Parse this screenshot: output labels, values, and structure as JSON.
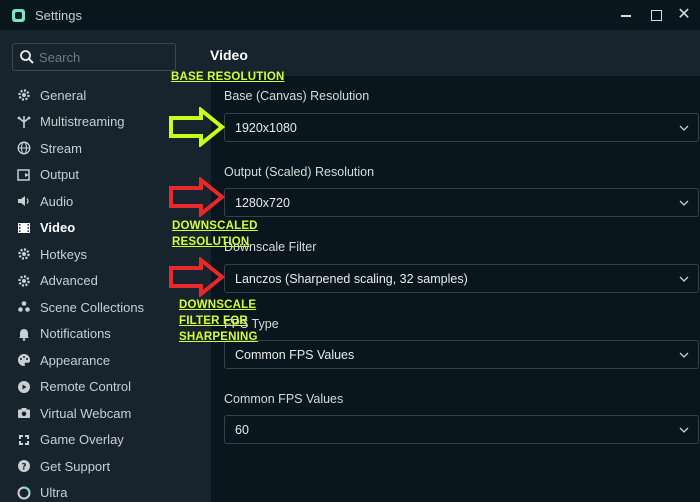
{
  "window": {
    "title": "Settings"
  },
  "search": {
    "placeholder": "Search"
  },
  "sidebar": {
    "items": [
      {
        "label": "General",
        "icon": "gear-icon"
      },
      {
        "label": "Multistreaming",
        "icon": "multistream-icon"
      },
      {
        "label": "Stream",
        "icon": "globe-icon"
      },
      {
        "label": "Output",
        "icon": "output-icon"
      },
      {
        "label": "Audio",
        "icon": "speaker-icon"
      },
      {
        "label": "Video",
        "icon": "film-icon"
      },
      {
        "label": "Hotkeys",
        "icon": "hotkeys-gear-icon"
      },
      {
        "label": "Advanced",
        "icon": "advanced-gear-icon"
      },
      {
        "label": "Scene Collections",
        "icon": "scene-collections-icon"
      },
      {
        "label": "Notifications",
        "icon": "bell-icon"
      },
      {
        "label": "Appearance",
        "icon": "palette-icon"
      },
      {
        "label": "Remote Control",
        "icon": "remote-icon"
      },
      {
        "label": "Virtual Webcam",
        "icon": "camera-icon"
      },
      {
        "label": "Game Overlay",
        "icon": "overlay-icon"
      },
      {
        "label": "Get Support",
        "icon": "support-icon"
      },
      {
        "label": "Ultra",
        "icon": "ultra-icon"
      }
    ],
    "active": "Video"
  },
  "main": {
    "title": "Video",
    "fields": [
      {
        "label": "Base (Canvas) Resolution",
        "value": "1920x1080"
      },
      {
        "label": "Output (Scaled) Resolution",
        "value": "1280x720"
      },
      {
        "label": "Downscale Filter",
        "value": "Lanczos (Sharpened scaling, 32 samples)"
      },
      {
        "label": "FPS Type",
        "value": "Common FPS Values"
      },
      {
        "label": "Common FPS Values",
        "value": "60"
      }
    ]
  },
  "annotations": {
    "base": "BASE RESOLUTION",
    "downscaled_1": "DOWNSCALED",
    "downscaled_2": "RESOLUTION",
    "filter_1": "DOWNSCALE",
    "filter_2": "FILTER FOR",
    "filter_3": "SHARPENING"
  },
  "colors": {
    "background": "#17242d",
    "panel": "#09161d",
    "annotation_text": "#d4ff33",
    "arrow_green": "#c6ff1a",
    "arrow_red": "#e8282b"
  }
}
